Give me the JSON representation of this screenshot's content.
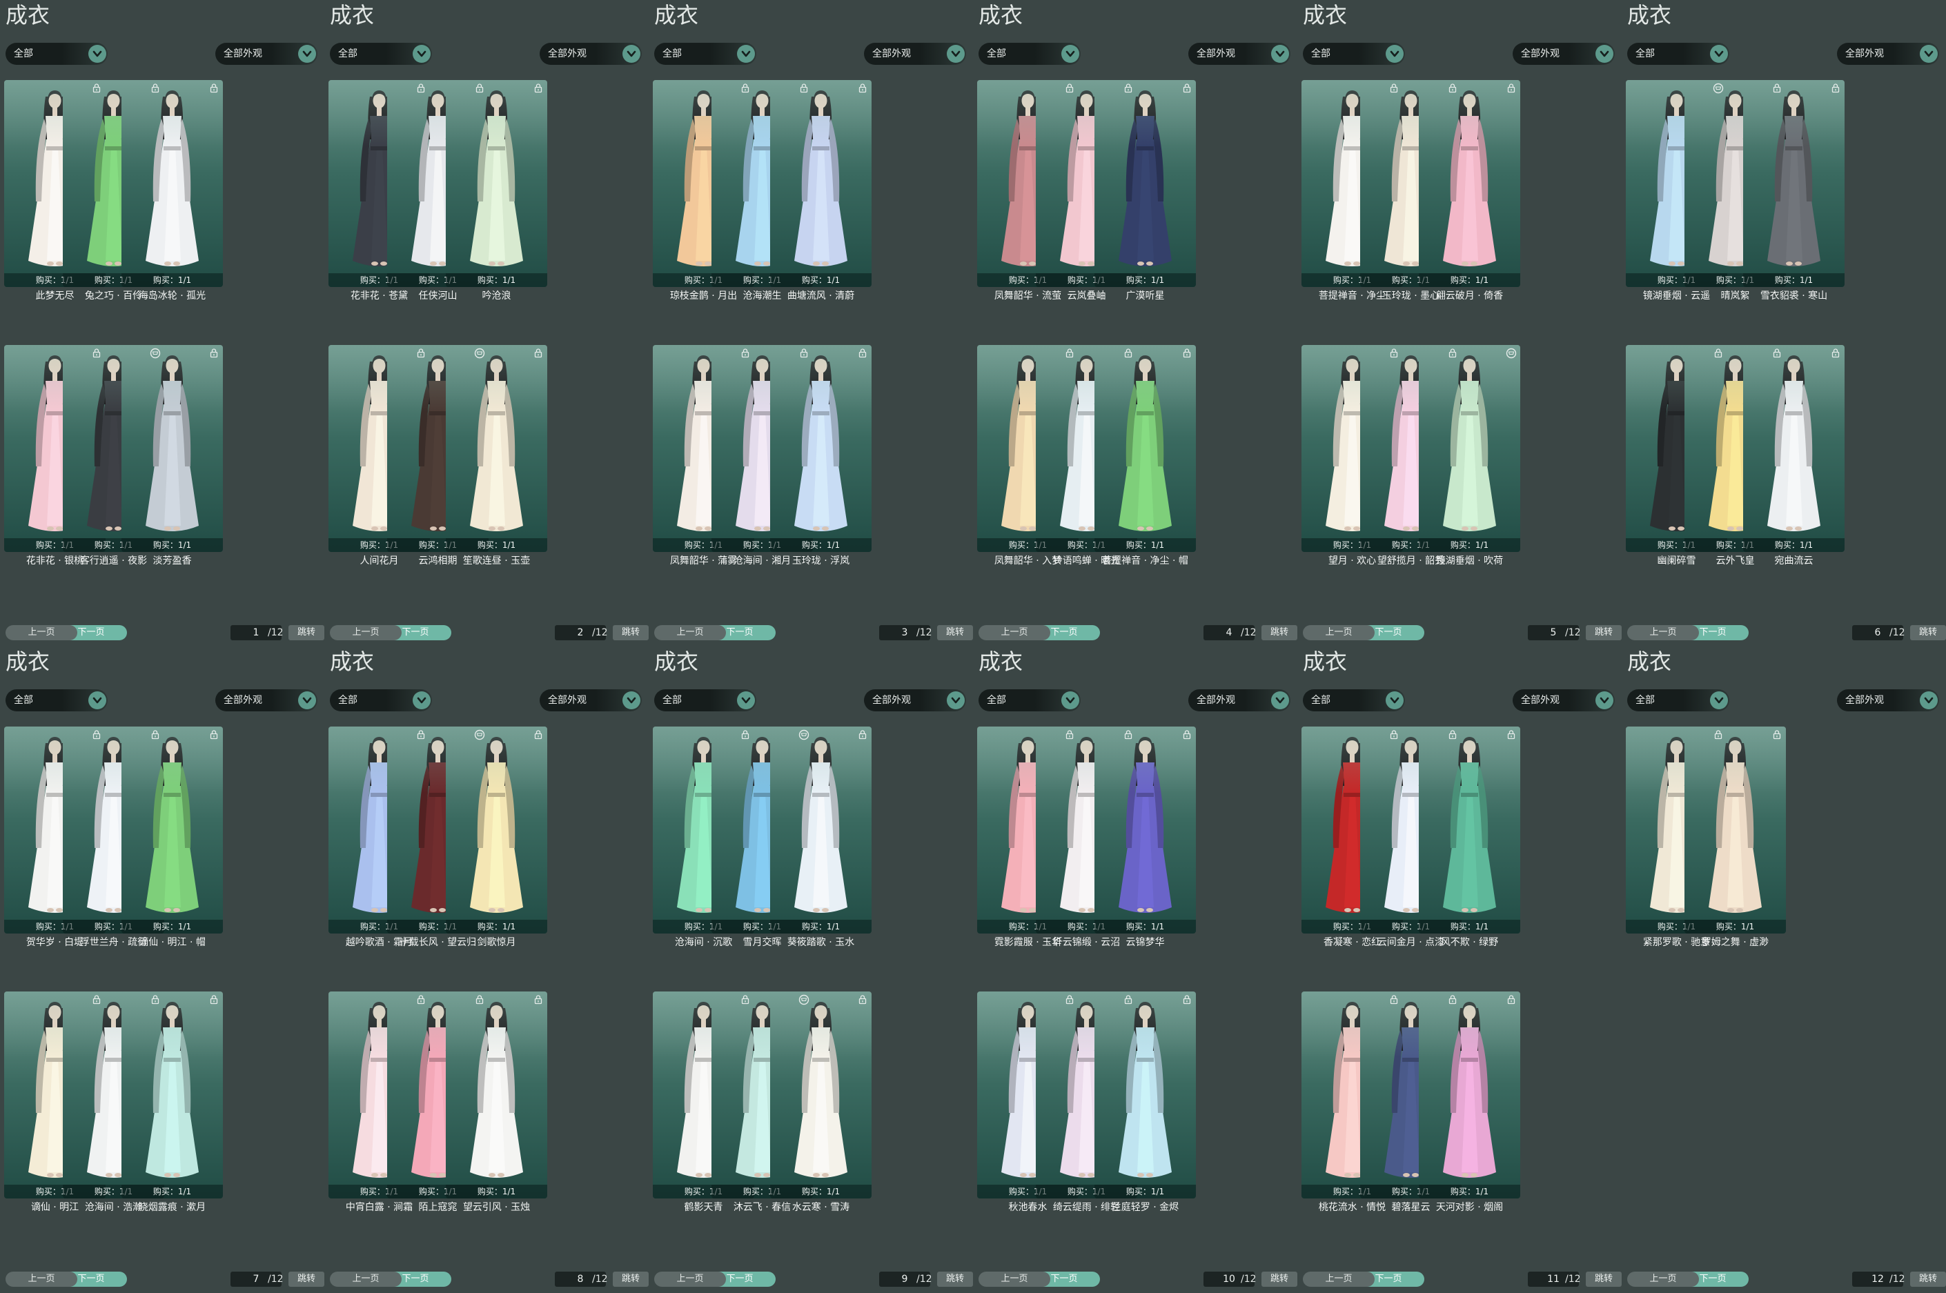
{
  "colors": {
    "background": "#3a4544",
    "card_top": "#6a9489",
    "card_bottom": "#214c45",
    "accent": "#6fb8a6"
  },
  "icons": {
    "dropdown": "chevron-down-icon",
    "lock": "lock-icon",
    "cart": "cart-icon"
  },
  "panels": [
    {
      "title": "成衣",
      "filter1": "全部",
      "filter2": "全部外观",
      "page": "1",
      "total": "/12",
      "prev": "上一页",
      "next": "下一页",
      "jump": "跳转",
      "items": [
        {
          "name": "此梦无尽",
          "buy": "购买：1/1",
          "color": "#f4efe8",
          "icon": "lock-icon"
        },
        {
          "name": "兔之巧 · 百伶",
          "buy": "购买：1/1",
          "color": "#7ecf7a",
          "icon": "lock-icon"
        },
        {
          "name": "海岛冰轮 · 孤光",
          "buy": "购买：1/1",
          "color": "#eef0f2",
          "icon": "lock-icon"
        },
        {
          "name": "花非花 · 银桃",
          "buy": "购买：1/1",
          "color": "#f4c8d2",
          "icon": "lock-icon"
        },
        {
          "name": "客行逍遥 · 夜影",
          "buy": "购买：1/1",
          "color": "#3a3d42",
          "icon": "cart-icon"
        },
        {
          "name": "淡芳盈香",
          "buy": "购买：1/1",
          "color": "#c4ccd4",
          "icon": "lock-icon"
        }
      ]
    },
    {
      "title": "成衣",
      "filter1": "全部",
      "filter2": "全部外观",
      "page": "2",
      "total": "/12",
      "prev": "上一页",
      "next": "下一页",
      "jump": "跳转",
      "items": [
        {
          "name": "花非花 · 苍黛",
          "buy": "购买：1/1",
          "color": "#3b3f48",
          "icon": "lock-icon"
        },
        {
          "name": "任侠河山",
          "buy": "购买：1/1",
          "color": "#e6e8ec",
          "icon": "lock-icon"
        },
        {
          "name": "吟沧浪",
          "buy": "购买：1/1",
          "color": "#d8ead0",
          "icon": "lock-icon"
        },
        {
          "name": "人间花月",
          "buy": "购买：1/1",
          "color": "#f1e6d6",
          "icon": "lock-icon"
        },
        {
          "name": "云鸿相期",
          "buy": "购买：1/1",
          "color": "#4a3a34",
          "icon": "cart-icon"
        },
        {
          "name": "笙歌连昼 · 玉壶",
          "buy": "购买：1/1",
          "color": "#f1e8d4",
          "icon": "lock-icon"
        }
      ]
    },
    {
      "title": "成衣",
      "filter1": "全部",
      "filter2": "全部外观",
      "page": "3",
      "total": "/12",
      "prev": "上一页",
      "next": "下一页",
      "jump": "跳转",
      "items": [
        {
          "name": "琼枝金鹊 · 月出",
          "buy": "购买：1/1",
          "color": "#f2c89a",
          "icon": "lock-icon"
        },
        {
          "name": "沧海潮生",
          "buy": "购买：1/1",
          "color": "#a8d4ee",
          "icon": "lock-icon"
        },
        {
          "name": "曲塘流风 · 清蔚",
          "buy": "购买：1/1",
          "color": "#c7d4f0",
          "icon": "lock-icon"
        },
        {
          "name": "凤舞韶华 · 蒲雾",
          "buy": "购买：1/1",
          "color": "#f3ece4",
          "icon": "lock-icon"
        },
        {
          "name": "沧海间 · 湘月",
          "buy": "购买：1/1",
          "color": "#e4dcec",
          "icon": "lock-icon"
        },
        {
          "name": "玉玲珑 · 浮岚",
          "buy": "购买：1/1",
          "color": "#c8dcf4",
          "icon": "lock-icon"
        }
      ]
    },
    {
      "title": "成衣",
      "filter1": "全部",
      "filter2": "全部外观",
      "page": "4",
      "total": "/12",
      "prev": "上一页",
      "next": "下一页",
      "jump": "跳转",
      "items": [
        {
          "name": "凤舞韶华 · 流萤",
          "buy": "购买：1/1",
          "color": "#c98a8e",
          "icon": "lock-icon"
        },
        {
          "name": "云岚叠岫",
          "buy": "购买：1/1",
          "color": "#f2c7cf",
          "icon": "lock-icon"
        },
        {
          "name": "广漠听星",
          "buy": "购买：1/1",
          "color": "#34406a",
          "icon": "lock-icon"
        },
        {
          "name": "凤舞韶华 · 入梦",
          "buy": "购买：1/1",
          "color": "#f0d8b0",
          "icon": "lock-icon"
        },
        {
          "name": "铃语鸣蝉 · 曦光",
          "buy": "购买：1/1",
          "color": "#e6eef2",
          "icon": "lock-icon"
        },
        {
          "name": "菩提禅音 · 净尘 · 帽",
          "buy": "购买：1/1",
          "color": "#7ecf7a",
          "icon": "lock-icon"
        }
      ]
    },
    {
      "title": "成衣",
      "filter1": "全部",
      "filter2": "全部外观",
      "page": "5",
      "total": "/12",
      "prev": "上一页",
      "next": "下一页",
      "jump": "跳转",
      "items": [
        {
          "name": "菩提禅音 · 净尘",
          "buy": "购买：1/1",
          "color": "#f4f2ee",
          "icon": "lock-icon"
        },
        {
          "name": "玉玲珑 · 墨心",
          "buy": "购买：1/1",
          "color": "#efe6d6",
          "icon": "lock-icon"
        },
        {
          "name": "翩云破月 · 倚香",
          "buy": "购买：1/1",
          "color": "#f2b8c8",
          "icon": "lock-icon"
        },
        {
          "name": "望月 · 欢心",
          "buy": "购买：1/1",
          "color": "#f4eee0",
          "icon": "lock-icon"
        },
        {
          "name": "望舒揽月 · 韶秀",
          "buy": "购买：1/1",
          "color": "#f4cfe0",
          "icon": "lock-icon"
        },
        {
          "name": "镜湖垂烟 · 吹荷",
          "buy": "购买：1/1",
          "color": "#c8e8cc",
          "icon": "cart-icon"
        }
      ]
    },
    {
      "title": "成衣",
      "filter1": "全部",
      "filter2": "全部外观",
      "page": "6",
      "total": "/12",
      "prev": "上一页",
      "next": "下一页",
      "jump": "跳转",
      "items": [
        {
          "name": "镜湖垂烟 · 云遥",
          "buy": "购买：1/1",
          "color": "#b8d8ee",
          "icon": "cart-icon"
        },
        {
          "name": "晴岚絮",
          "buy": "购买：1/1",
          "color": "#d8d2d0",
          "icon": "lock-icon"
        },
        {
          "name": "雪衣貂裘 · 寒山",
          "buy": "购买：1/1",
          "color": "#6a6e74",
          "icon": "lock-icon"
        },
        {
          "name": "幽阑碎雪",
          "buy": "购买：1/1",
          "color": "#2c3032",
          "icon": "lock-icon"
        },
        {
          "name": "云外飞皇",
          "buy": "购买：1/1",
          "color": "#f3dc90",
          "icon": "lock-icon"
        },
        {
          "name": "宛曲流云",
          "buy": "购买：1/1",
          "color": "#eceff1",
          "icon": "lock-icon"
        }
      ]
    },
    {
      "title": "成衣",
      "filter1": "全部",
      "filter2": "全部外观",
      "page": "7",
      "total": "/12",
      "prev": "上一页",
      "next": "下一页",
      "jump": "跳转",
      "items": [
        {
          "name": "贺华岁 · 白堤",
          "buy": "购买：1/1",
          "color": "#f2f2f0",
          "icon": "lock-icon"
        },
        {
          "name": "浮世兰舟 · 疏衍",
          "buy": "购买：1/1",
          "color": "#eef2f6",
          "icon": "lock-icon"
        },
        {
          "name": "谪仙 · 明江 · 帽",
          "buy": "购买：1/1",
          "color": "#7ecf7a",
          "icon": "lock-icon"
        },
        {
          "name": "谪仙 · 明江",
          "buy": "购买：1/1",
          "color": "#f4ecd6",
          "icon": "lock-icon"
        },
        {
          "name": "沧海间 · 浩瀚",
          "buy": "购买：1/1",
          "color": "#f0f2f2",
          "icon": "lock-icon"
        },
        {
          "name": "晓烟露痕 · 漱月",
          "buy": "购买：1/1",
          "color": "#bfe8e0",
          "icon": "lock-icon"
        }
      ]
    },
    {
      "title": "成衣",
      "filter1": "全部",
      "filter2": "全部外观",
      "page": "8",
      "total": "/12",
      "prev": "上一页",
      "next": "下一页",
      "jump": "跳转",
      "items": [
        {
          "name": "越吟歌酒 · 霜月",
          "buy": "购买：1/1",
          "color": "#aac0ee",
          "icon": "lock-icon"
        },
        {
          "name": "十载长风 · 望云归",
          "buy": "购买：1/1",
          "color": "#6a2a2c",
          "icon": "cart-icon"
        },
        {
          "name": "剑歌惊月",
          "buy": "购买：1/1",
          "color": "#f4e6b4",
          "icon": "lock-icon"
        },
        {
          "name": "中宵白露 · 涧霜",
          "buy": "购买：1/1",
          "color": "#f6dce0",
          "icon": "lock-icon"
        },
        {
          "name": "陌上寇窕",
          "buy": "购买：1/1",
          "color": "#f4a8b8",
          "icon": "lock-icon"
        },
        {
          "name": "望云引风 · 玉烛",
          "buy": "购买：1/1",
          "color": "#f4f4f2",
          "icon": "lock-icon"
        }
      ]
    },
    {
      "title": "成衣",
      "filter1": "全部",
      "filter2": "全部外观",
      "page": "9",
      "total": "/12",
      "prev": "上一页",
      "next": "下一页",
      "jump": "跳转",
      "items": [
        {
          "name": "沧海间 · 沉歌",
          "buy": "购买：1/1",
          "color": "#8ae0b8",
          "icon": "lock-icon"
        },
        {
          "name": "雪月交晖",
          "buy": "购买：1/1",
          "color": "#7ec0e4",
          "icon": "cart-icon"
        },
        {
          "name": "葵筱踏歌 · 玉水",
          "buy": "购买：1/1",
          "color": "#e8f0f6",
          "icon": "lock-icon"
        },
        {
          "name": "鹤影天青",
          "buy": "购买：1/1",
          "color": "#f2f2f0",
          "icon": "lock-icon"
        },
        {
          "name": "沐云飞 · 春信",
          "buy": "购买：1/1",
          "color": "#c4e8e0",
          "icon": "cart-icon"
        },
        {
          "name": "水云寒 · 雪涛",
          "buy": "购买：1/1",
          "color": "#f4f2ea",
          "icon": "lock-icon"
        }
      ]
    },
    {
      "title": "成衣",
      "filter1": "全部",
      "filter2": "全部外观",
      "page": "10",
      "total": "/12",
      "prev": "上一页",
      "next": "下一页",
      "jump": "跳转",
      "items": [
        {
          "name": "霓影霞服 · 玉华",
          "buy": "购买：1/1",
          "color": "#f4b0b8",
          "icon": "lock-icon"
        },
        {
          "name": "纤云锦缎 · 云沼",
          "buy": "购买：1/1",
          "color": "#f2eef0",
          "icon": "lock-icon"
        },
        {
          "name": "云锦梦华",
          "buy": "购买：1/1",
          "color": "#6a64c8",
          "icon": "lock-icon"
        },
        {
          "name": "秋池春水",
          "buy": "购买：1/1",
          "color": "#e2e6f2",
          "icon": "lock-icon"
        },
        {
          "name": "绮云缇雨 · 绯轻",
          "buy": "购买：1/1",
          "color": "#ecdcec",
          "icon": "lock-icon"
        },
        {
          "name": "兰庭轻罗 · 金烬",
          "buy": "购买：1/1",
          "color": "#bfe4f0",
          "icon": "lock-icon"
        }
      ]
    },
    {
      "title": "成衣",
      "filter1": "全部",
      "filter2": "全部外观",
      "page": "11",
      "total": "/12",
      "prev": "上一页",
      "next": "下一页",
      "jump": "跳转",
      "items": [
        {
          "name": "香凝寒 · 恋红",
          "buy": "购买：1/1",
          "color": "#c42828",
          "icon": "lock-icon"
        },
        {
          "name": "云间金月 · 点漆",
          "buy": "购买：1/1",
          "color": "#e8eef8",
          "icon": "lock-icon"
        },
        {
          "name": "风不欺 · 绿野",
          "buy": "购买：1/1",
          "color": "#5eb89a",
          "icon": "lock-icon"
        },
        {
          "name": "桃花流水 · 情悦",
          "buy": "购买：1/1",
          "color": "#f6c8c4",
          "icon": "lock-icon"
        },
        {
          "name": "碧落星云",
          "buy": "购买：1/1",
          "color": "#4a5a8a",
          "icon": "lock-icon"
        },
        {
          "name": "天河对影 · 烟阁",
          "buy": "购买：1/1",
          "color": "#e8a8d4",
          "icon": "lock-icon"
        }
      ]
    },
    {
      "title": "成衣",
      "filter1": "全部",
      "filter2": "全部外观",
      "page": "12",
      "total": "/12",
      "prev": "上一页",
      "next": "下一页",
      "jump": "跳转",
      "items": [
        {
          "name": "紧那罗歌 · 驰意",
          "buy": "购买：1/1",
          "color": "#f0e8d6",
          "icon": "lock-icon"
        },
        {
          "name": "罗姆之舞 · 虚渺",
          "buy": "购买：1/1",
          "color": "#eedcc8",
          "icon": "lock-icon"
        }
      ]
    }
  ]
}
